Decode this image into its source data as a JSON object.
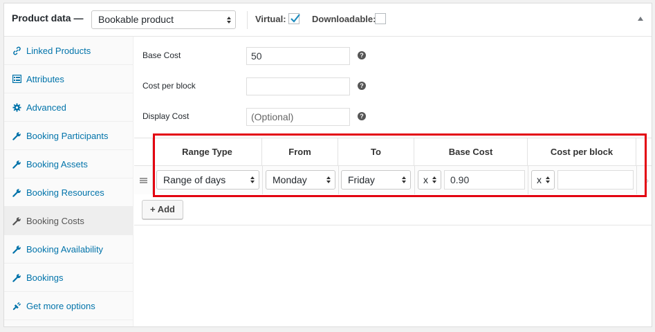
{
  "header": {
    "title": "Product data —",
    "product_type": "Bookable product",
    "virtual_label": "Virtual:",
    "virtual_checked": true,
    "downloadable_label": "Downloadable:",
    "downloadable_checked": false
  },
  "sidebar": {
    "items": [
      {
        "label": "Linked Products",
        "icon": "link-icon",
        "active": false
      },
      {
        "label": "Attributes",
        "icon": "list-table-icon",
        "active": false
      },
      {
        "label": "Advanced",
        "icon": "gear-icon",
        "active": false
      },
      {
        "label": "Booking Participants",
        "icon": "wrench-icon",
        "active": false
      },
      {
        "label": "Booking Assets",
        "icon": "wrench-icon",
        "active": false
      },
      {
        "label": "Booking Resources",
        "icon": "wrench-icon",
        "active": false
      },
      {
        "label": "Booking Costs",
        "icon": "wrench-icon",
        "active": true
      },
      {
        "label": "Booking Availability",
        "icon": "wrench-icon",
        "active": false
      },
      {
        "label": "Bookings",
        "icon": "wrench-icon",
        "active": false
      },
      {
        "label": "Get more options",
        "icon": "plugin-icon",
        "active": false
      }
    ]
  },
  "fields": {
    "base_cost": {
      "label": "Base Cost",
      "value": "50",
      "help": "?"
    },
    "cost_per_block": {
      "label": "Cost per block",
      "value": "",
      "help": "?"
    },
    "display_cost": {
      "label": "Display Cost",
      "value": "",
      "placeholder": "(Optional)",
      "help": "?"
    }
  },
  "cost_table": {
    "headers": [
      "Range Type",
      "From",
      "To",
      "Base Cost",
      "Cost per block"
    ],
    "rows": [
      {
        "range_type": "Range of days",
        "from": "Monday",
        "to": "Friday",
        "base_cost_modifier": "x",
        "base_cost": "0.90",
        "block_cost_modifier": "x",
        "block_cost": ""
      }
    ]
  },
  "add_button": {
    "label": "+ Add"
  },
  "colors": {
    "link": "#0073aa",
    "highlight": "#e3000f",
    "checkbox_check": "#1e8cbe"
  }
}
